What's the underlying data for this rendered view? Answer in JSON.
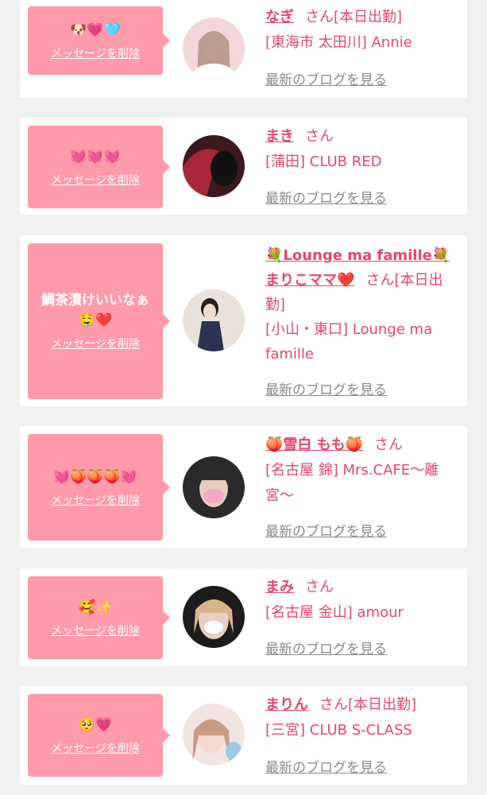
{
  "delete_label": "メッセージを削除",
  "blog_label": "最新のブログを見る",
  "san_label": "さん",
  "cards": [
    {
      "message": "🐶💗🩵",
      "name": "なぎ",
      "status": "[本日出勤]",
      "shop": "[東海市 太田川] Annie",
      "avatar_colors": [
        "#f3d6d9",
        "#c9a28e",
        "#8a6b58"
      ]
    },
    {
      "message": "💓💓💓",
      "name": "まき",
      "status": "",
      "shop": "[蒲田] CLUB RED",
      "avatar_colors": [
        "#3a1a1f",
        "#a8283a",
        "#111111"
      ]
    },
    {
      "message": "鯛茶漬けいいなぁ\n🤤❤️",
      "name_prefix": "💐Lounge ma famille💐",
      "name": "まりこママ❤️",
      "status": "[本日出勤]",
      "shop": "[小山・東口] Lounge ma famille",
      "avatar_colors": [
        "#e9e2da",
        "#2b3350",
        "#c8b8a6"
      ]
    },
    {
      "message": "💓🍑🍑🍑💓",
      "name": "🍑雪白 もも🍑",
      "status": "",
      "shop": "[名古屋 錦] Mrs.CAFE〜離宮〜",
      "avatar_colors": [
        "#2a2a2a",
        "#f5a8c8",
        "#d9b9a8"
      ]
    },
    {
      "message": "🥰✨",
      "name": "まみ",
      "status": "",
      "shop": "[名古屋 金山] amour",
      "avatar_colors": [
        "#1c1c1c",
        "#e8cfc0",
        "#ffffff"
      ]
    },
    {
      "message": "🥺💗",
      "name": "まりん",
      "status": "[本日出勤]",
      "shop": "[三宮] CLUB S-CLASS",
      "avatar_colors": [
        "#f2e4e0",
        "#c89a86",
        "#a0c8e8"
      ]
    }
  ]
}
